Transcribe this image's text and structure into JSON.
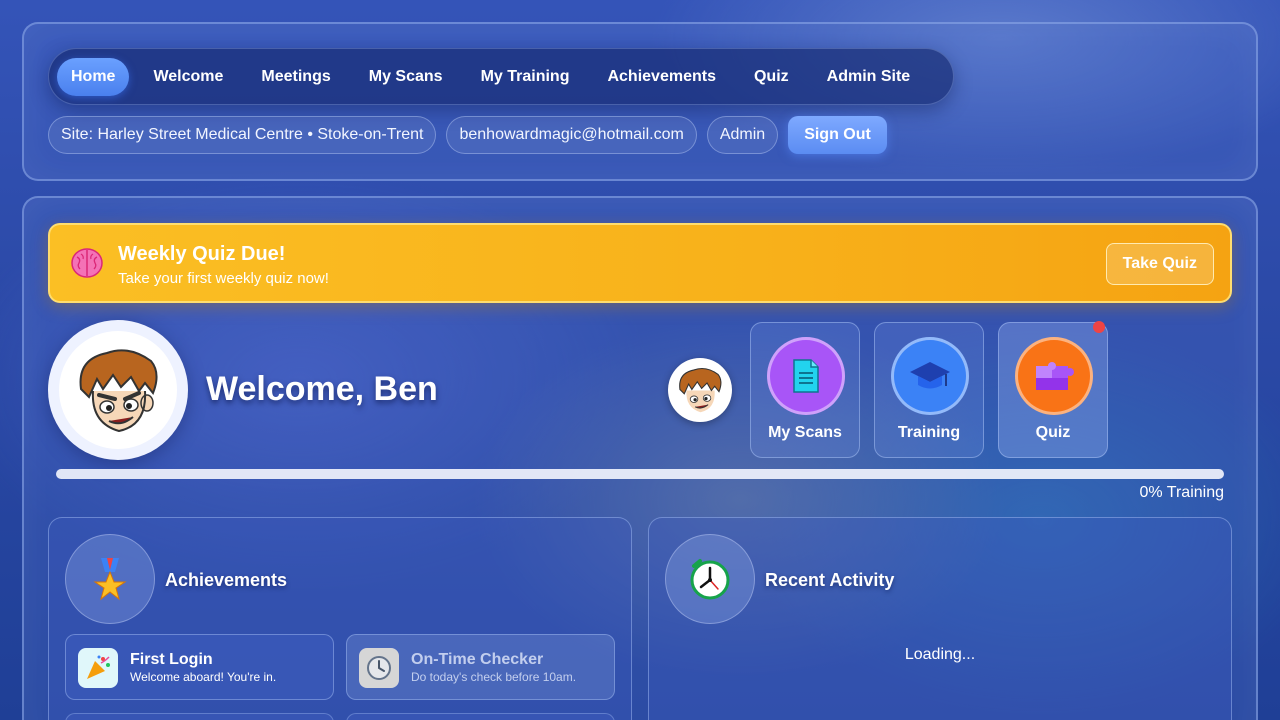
{
  "nav": {
    "items": [
      {
        "label": "Home",
        "active": true
      },
      {
        "label": "Welcome"
      },
      {
        "label": "Meetings"
      },
      {
        "label": "My Scans"
      },
      {
        "label": "My Training"
      },
      {
        "label": "Achievements"
      },
      {
        "label": "Quiz"
      },
      {
        "label": "Admin Site"
      }
    ]
  },
  "info": {
    "site": "Site: Harley Street Medical Centre • Stoke-on-Trent",
    "email": "benhowardmagic@hotmail.com",
    "role": "Admin",
    "sign_out": "Sign Out"
  },
  "banner": {
    "icon": "brain-icon",
    "title": "Weekly Quiz Due!",
    "subtitle": "Take your first weekly quiz now!",
    "button": "Take Quiz",
    "color": "#fbbf24"
  },
  "welcome": {
    "title": "Welcome, Ben",
    "avatar": "cartoon-avatar"
  },
  "quick_links": [
    {
      "label": "My Scans",
      "icon": "document-icon",
      "color": "#a855f7"
    },
    {
      "label": "Training",
      "icon": "graduation-cap-icon",
      "color": "#3b82f6"
    },
    {
      "label": "Quiz",
      "icon": "puzzle-icon",
      "color": "#f97316",
      "badge": true
    }
  ],
  "progress": {
    "value": 0,
    "label": "0% Training"
  },
  "achievements": {
    "title": "Achievements",
    "icon": "medal-icon",
    "items": [
      {
        "title": "First Login",
        "desc": "Welcome aboard! You're in.",
        "icon": "party-popper-icon",
        "unlocked": true
      },
      {
        "title": "On-Time Checker",
        "desc": "Do today's check before 10am.",
        "icon": "clock-icon",
        "unlocked": false
      }
    ]
  },
  "activity": {
    "title": "Recent Activity",
    "icon": "alarm-clock-icon",
    "loading": "Loading..."
  },
  "colors": {
    "accent": "#5b8cf2",
    "background": "#2c4aa8"
  }
}
